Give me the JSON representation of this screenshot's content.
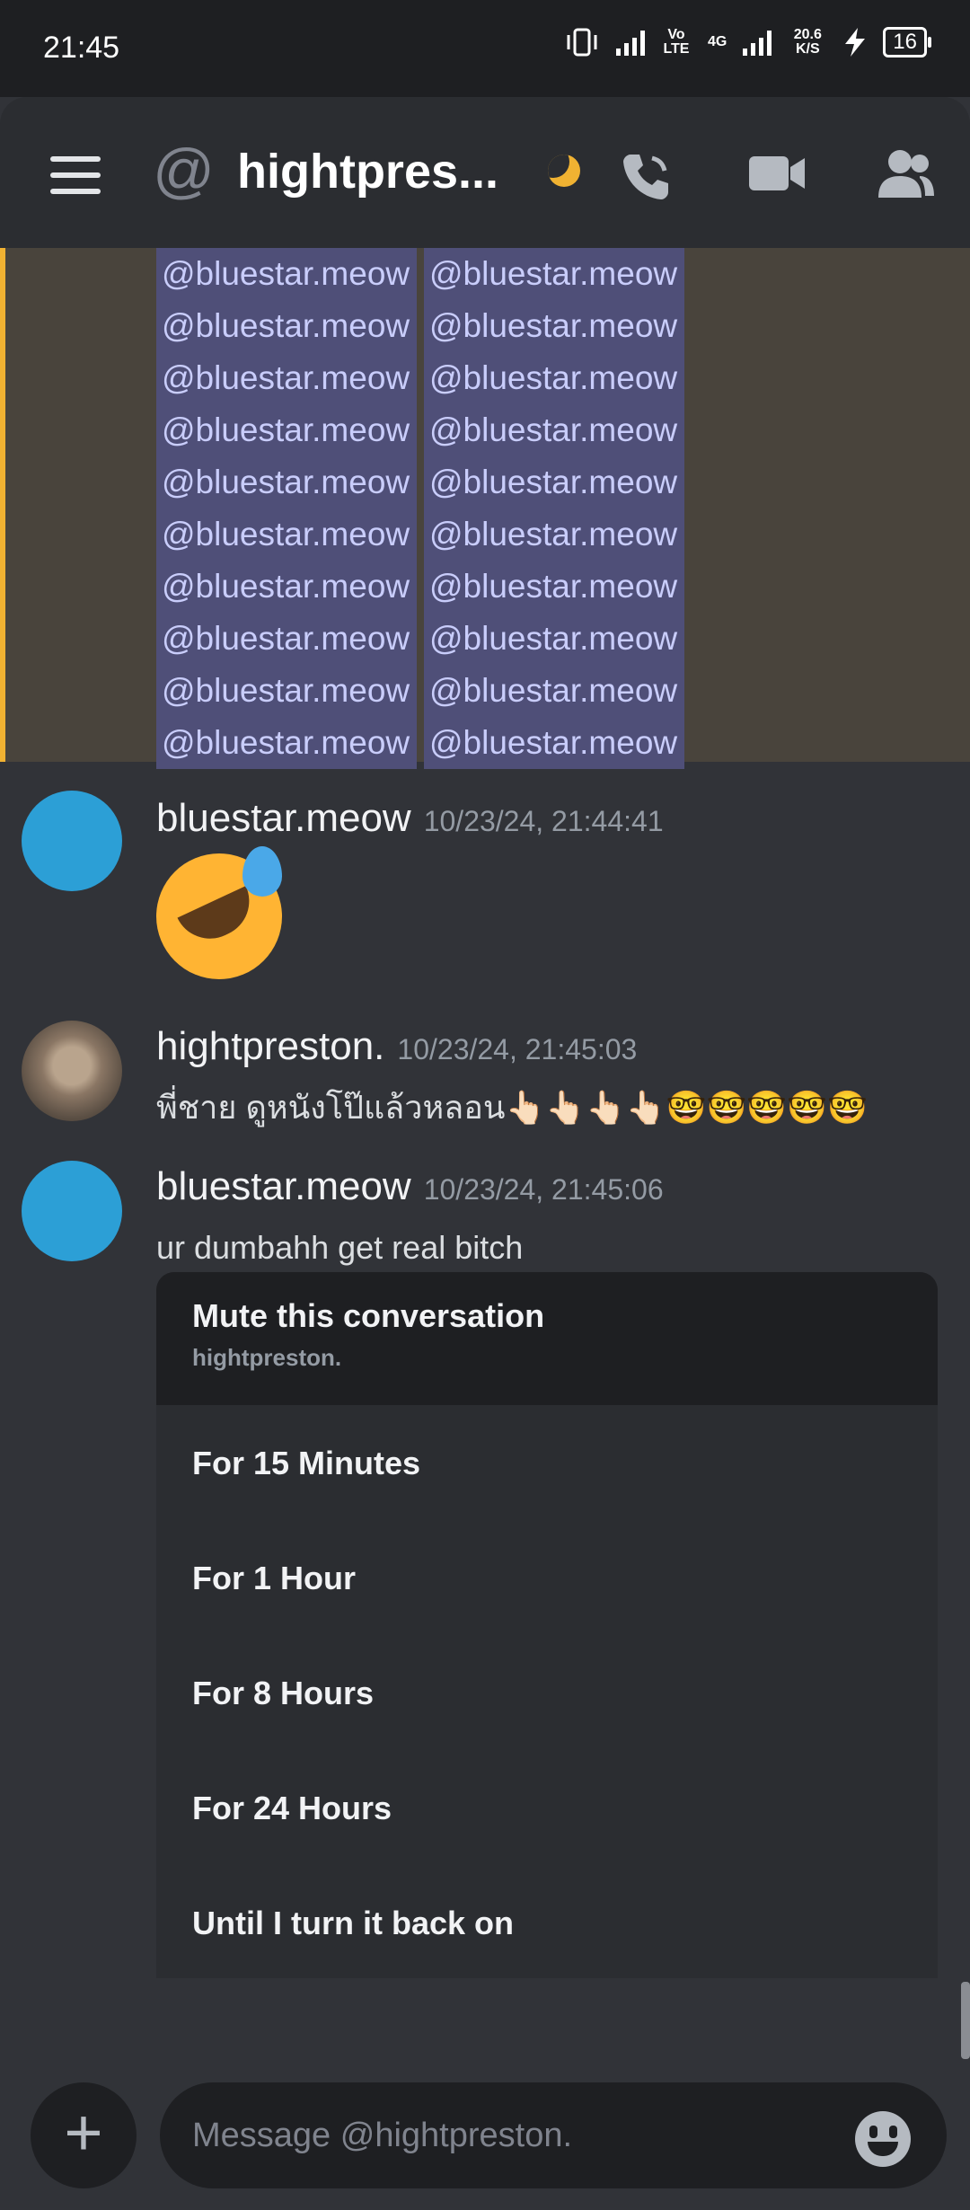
{
  "status_bar": {
    "time": "21:45",
    "volte": "Vo LTE",
    "network": "4G",
    "speed": "20.6 K/S",
    "battery": "16"
  },
  "header": {
    "title": "hightpres...",
    "icons": [
      "menu-icon",
      "at-icon",
      "moon-icon",
      "call-icon",
      "video-icon",
      "members-icon"
    ]
  },
  "mentions": {
    "rows": [
      [
        "@bluestar.meow",
        "@bluestar.meow"
      ],
      [
        "@bluestar.meow",
        "@bluestar.meow"
      ],
      [
        "@bluestar.meow",
        "@bluestar.meow"
      ],
      [
        "@bluestar.meow",
        "@bluestar.meow"
      ],
      [
        "@bluestar.meow",
        "@bluestar.meow"
      ],
      [
        "@bluestar.meow",
        "@bluestar.meow"
      ],
      [
        "@bluestar.meow",
        "@bluestar.meow"
      ],
      [
        "@bluestar.meow",
        "@bluestar.meow"
      ],
      [
        "@bluestar.meow",
        "@bluestar.meow"
      ],
      [
        "@bluestar.meow",
        "@bluestar.meow"
      ]
    ]
  },
  "messages": [
    {
      "author": "bluestar.meow",
      "timestamp": "10/23/24, 21:44:41",
      "content_emoji": "rolling-on-floor-laughing"
    },
    {
      "author": "hightpreston.",
      "timestamp": "10/23/24, 21:45:03",
      "content": "พี่ชาย ดูหนังโป๊แล้วหลอน👆🏻👆🏻👆🏻👆🏻🤓🤓🤓🤓🤓"
    },
    {
      "author": "bluestar.meow",
      "timestamp": "10/23/24, 21:45:06",
      "content": "ur dumbahh get real bitch"
    }
  ],
  "mute_menu": {
    "title": "Mute this conversation",
    "subtitle": "hightpreston.",
    "options": [
      "For 15 Minutes",
      "For 1 Hour",
      "For 8 Hours",
      "For 24 Hours",
      "Until I turn it back on"
    ]
  },
  "composer": {
    "placeholder": "Message @hightpreston.",
    "attach_label": "+"
  }
}
